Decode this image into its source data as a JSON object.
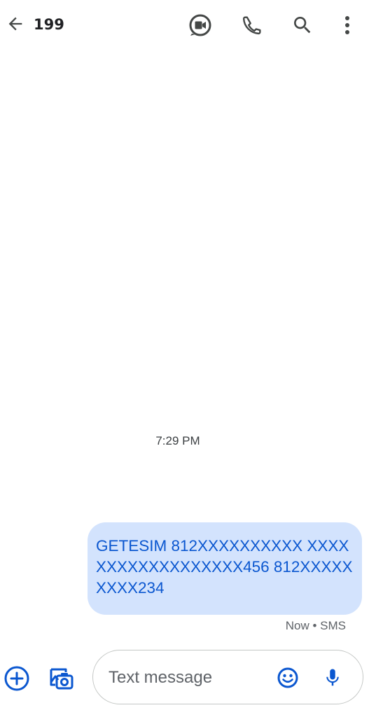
{
  "header": {
    "title": "199",
    "back_icon": "arrow-back-icon",
    "video_icon": "video-call-icon",
    "call_icon": "phone-icon",
    "search_icon": "search-icon",
    "more_icon": "more-vertical-icon"
  },
  "conversation": {
    "timestamp": "7:29 PM",
    "messages": [
      {
        "text": "GETESIM 812XXXXXXXXXX XXXXXXXXXXXXXXXXXX456 812XXXXXXXXX234",
        "meta": "Now • SMS",
        "direction": "outgoing"
      }
    ]
  },
  "compose": {
    "placeholder": "Text message",
    "value": "",
    "add_icon": "add-circle-icon",
    "gallery_icon": "gallery-camera-icon",
    "emoji_icon": "emoji-icon",
    "mic_icon": "mic-icon"
  },
  "colors": {
    "icon": "#444746",
    "accent": "#0b57d0",
    "bubble_bg": "#d3e3fd",
    "text_primary": "#202124",
    "text_secondary": "#5f6368"
  }
}
